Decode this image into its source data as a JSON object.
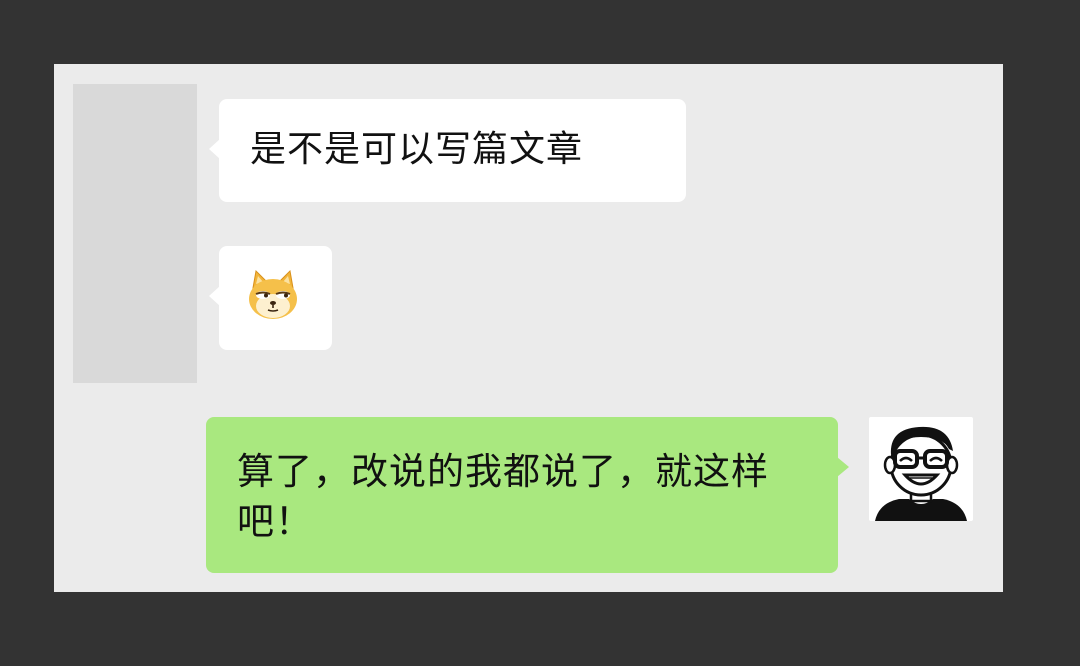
{
  "conversation": {
    "messages": [
      {
        "side": "left",
        "type": "text",
        "text": "是不是可以写篇文章"
      },
      {
        "side": "left",
        "type": "emoji",
        "icon": "doge-emoji-icon"
      },
      {
        "side": "right",
        "type": "text",
        "text": "算了，改说的我都说了，就这样吧！"
      }
    ]
  },
  "colors": {
    "background": "#333333",
    "chat_background": "#ebebeb",
    "incoming_bubble": "#ffffff",
    "outgoing_bubble": "#a9e87f",
    "avatar_placeholder": "#d9d9d9"
  }
}
